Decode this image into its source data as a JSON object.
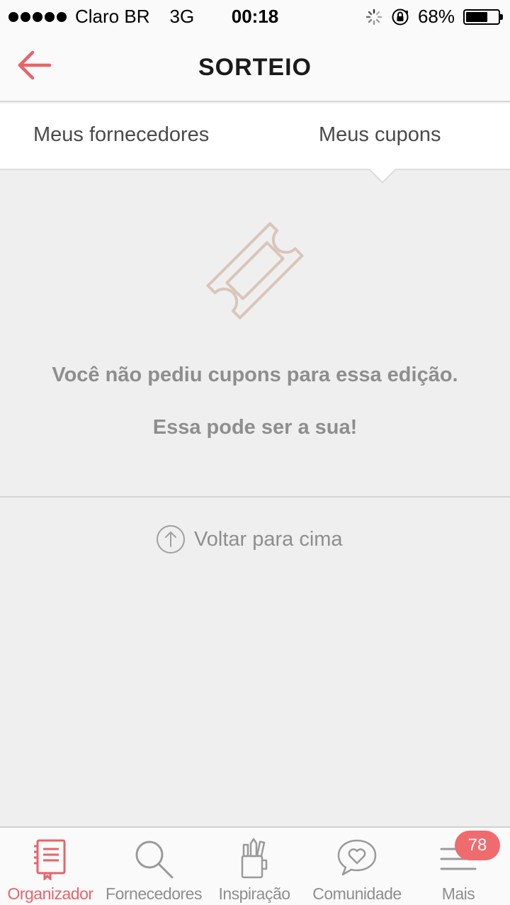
{
  "status_bar": {
    "carrier": "Claro BR",
    "network": "3G",
    "time": "00:18",
    "battery_percent": "68%",
    "battery_level": 0.68
  },
  "header": {
    "title": "SORTEIO"
  },
  "tabs": [
    {
      "label": "Meus fornecedores",
      "selected": false
    },
    {
      "label": "Meus cupons",
      "selected": true
    }
  ],
  "empty_state": {
    "message": "Você não pediu cupons para essa edição.",
    "sub_message": "Essa pode ser a sua!"
  },
  "back_to_top": {
    "label": "Voltar para cima"
  },
  "bottom_nav": {
    "items": [
      {
        "label": "Organizador",
        "icon": "notebook-icon",
        "active": true
      },
      {
        "label": "Fornecedores",
        "icon": "search-icon",
        "active": false
      },
      {
        "label": "Inspiração",
        "icon": "pencil-cup-icon",
        "active": false
      },
      {
        "label": "Comunidade",
        "icon": "heart-chat-icon",
        "active": false
      },
      {
        "label": "Mais",
        "icon": "menu-icon",
        "active": false
      }
    ],
    "badge_count": "78"
  },
  "colors": {
    "accent": "#e8636a",
    "badge": "#f06b6e",
    "coupon_icon": "#d9c6b8",
    "muted_text": "#8e8e8e"
  }
}
